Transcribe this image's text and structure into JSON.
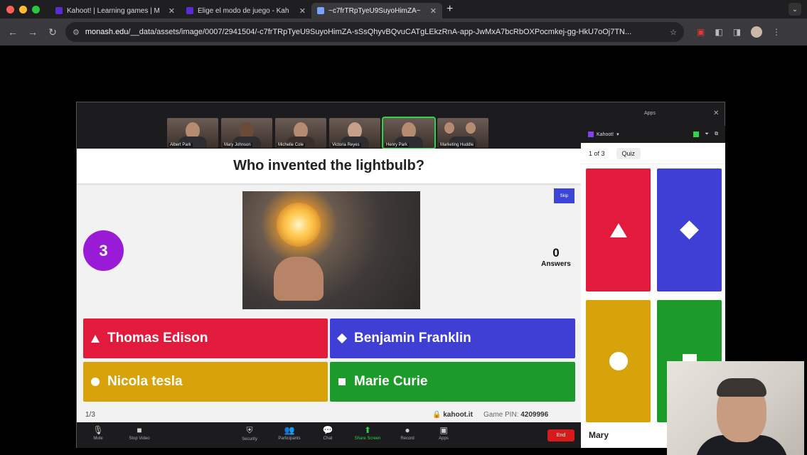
{
  "browser": {
    "tabs": [
      {
        "title": "Kahoot! | Learning games | M",
        "active": false,
        "favicon_color": "#5a2dd1"
      },
      {
        "title": "Elige el modo de juego - Kah",
        "active": false,
        "favicon_color": "#5a2dd1"
      },
      {
        "title": "~c7frTRpTyeU9SuyoHimZA~",
        "active": true,
        "favicon_color": "#7aa3ff"
      }
    ],
    "new_tab": "+",
    "url_domain": "monash.edu",
    "url_path": "/__data/assets/image/0007/2941504/-c7frTRpTyeU9SuyoHimZA-sSsQhyvBQvuCATgLEkzRnA-app-JwMxA7bcRbOXPocmkej-gg-HkU7oOj7TN..."
  },
  "zoom": {
    "apps_label": "Apps",
    "participants": [
      {
        "name": "Albert Park"
      },
      {
        "name": "Mary Johnson"
      },
      {
        "name": "Michelle Cole"
      },
      {
        "name": "Victoria Reyes"
      },
      {
        "name": "Henry Park",
        "active": true
      },
      {
        "name": "Marketing Huddle"
      }
    ],
    "controls": [
      {
        "icon": "mic-icon",
        "glyph": "🎙",
        "label": "Mute"
      },
      {
        "icon": "video-icon",
        "glyph": "■",
        "label": "Stop Video"
      },
      {
        "icon": "shield-icon",
        "glyph": "⛨",
        "label": "Security"
      },
      {
        "icon": "participants-icon",
        "glyph": "👥",
        "label": "Participants"
      },
      {
        "icon": "chat-icon",
        "glyph": "💬",
        "label": "Chat"
      },
      {
        "icon": "share-screen-icon",
        "glyph": "⬆",
        "label": "Share Screen"
      },
      {
        "icon": "record-icon",
        "glyph": "●",
        "label": "Record"
      },
      {
        "icon": "apps-icon",
        "glyph": "▣",
        "label": "Apps"
      }
    ],
    "end_label": "End"
  },
  "kahoot": {
    "question": "Who invented the lightbulb?",
    "timer": "3",
    "skip_label": "Skip",
    "answers_count": "0",
    "answers_label": "Answers",
    "answers": [
      {
        "text": "Thomas Edison",
        "shape": "triangle",
        "color": "#e21b3c"
      },
      {
        "text": "Benjamin Franklin",
        "shape": "diamond",
        "color": "#3f3fd6"
      },
      {
        "text": "Nicola tesla",
        "shape": "circle",
        "color": "#d8a20a"
      },
      {
        "text": "Marie Curie",
        "shape": "square",
        "color": "#1d9b2a"
      }
    ],
    "progress": "1/3",
    "site": "🔒 kahoot.it",
    "game_pin_label": "Game PIN:",
    "game_pin": "4209996"
  },
  "side_panel": {
    "app_name": "Kahoot!",
    "progress": "1 of 3",
    "mode": "Quiz",
    "player": "Mary"
  }
}
